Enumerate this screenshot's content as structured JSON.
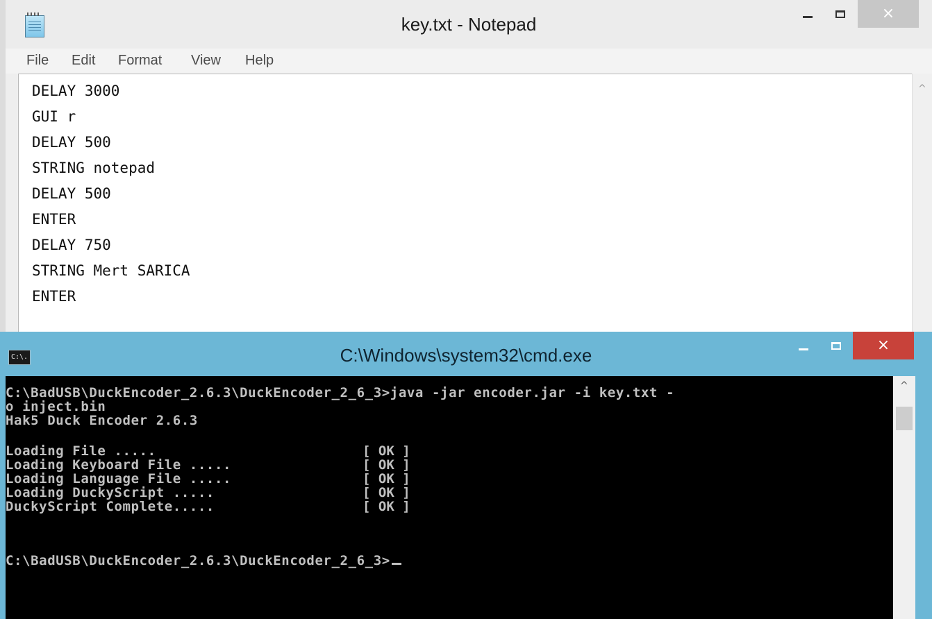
{
  "notepad": {
    "title": "key.txt - Notepad",
    "controls": {
      "minimize": "–",
      "maximize": "□",
      "close": "×"
    },
    "menu": [
      "File",
      "Edit",
      "Format",
      "View",
      "Help"
    ],
    "lines": [
      "DELAY 3000",
      "GUI r",
      "DELAY 500",
      "STRING notepad",
      "DELAY 500",
      "ENTER",
      "DELAY 750",
      "STRING Mert SARICA",
      "ENTER"
    ],
    "scroll_up": "^"
  },
  "cmd": {
    "title": "C:\\Windows\\system32\\cmd.exe",
    "icon_text": "C:\\.",
    "controls": {
      "minimize": "–",
      "maximize": "□",
      "close": "×"
    },
    "command_line_1": "C:\\BadUSB\\DuckEncoder_2.6.3\\DuckEncoder_2_6_3>java -jar encoder.jar -i key.txt -",
    "command_line_2": "o inject.bin",
    "banner": "Hak5 Duck Encoder 2.6.3",
    "steps": [
      {
        "label": "Loading File .....",
        "status": "[ OK ]"
      },
      {
        "label": "Loading Keyboard File .....",
        "status": "[ OK ]"
      },
      {
        "label": "Loading Language File .....",
        "status": "[ OK ]"
      },
      {
        "label": "Loading DuckyScript .....",
        "status": "[ OK ]"
      },
      {
        "label": "DuckyScript Complete.....",
        "status": "[ OK ]"
      }
    ],
    "prompt": "C:\\BadUSB\\DuckEncoder_2.6.3\\DuckEncoder_2_6_3>",
    "scroll_up": "^"
  },
  "colors": {
    "cmd_frame": "#6cb7d6",
    "cmd_close": "#c8423a",
    "console_bg": "#000000",
    "console_text": "#c0c0c0"
  }
}
